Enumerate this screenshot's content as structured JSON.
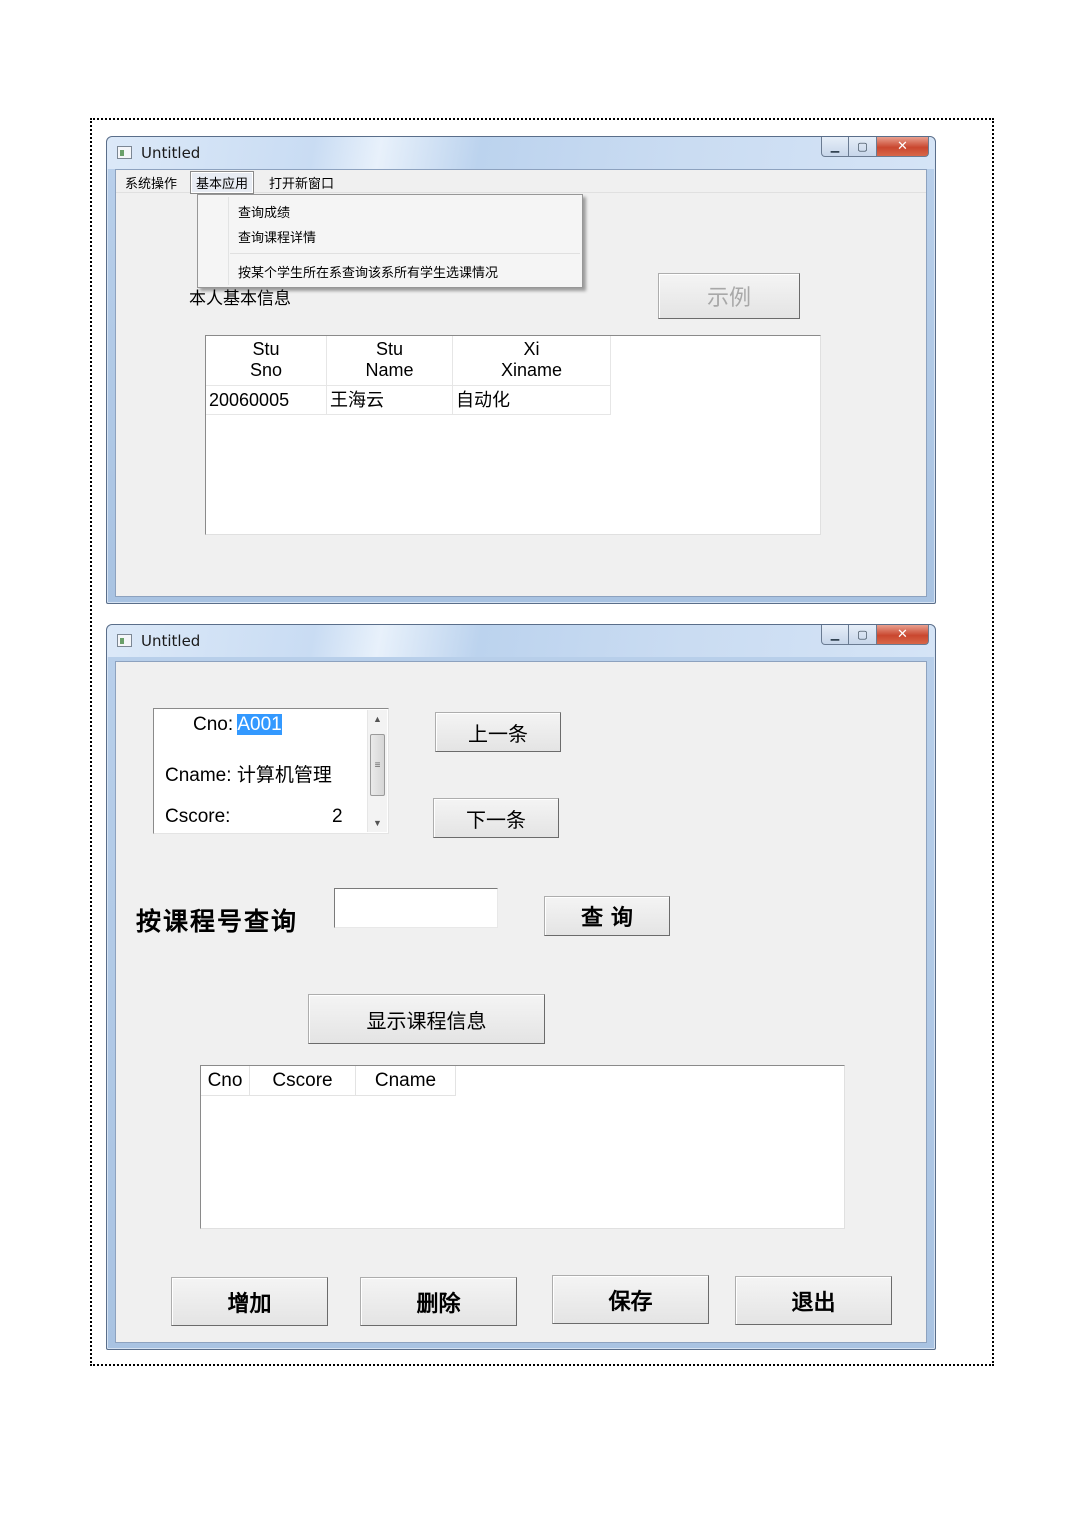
{
  "window1": {
    "title": "Untitled",
    "menu": [
      "系统操作",
      "基本应用",
      "打开新窗口"
    ],
    "dropdown": [
      "查询成绩",
      "查询课程详情",
      "按某个学生所在系查询该系所有学生选课情况"
    ],
    "basic_info_label": "本人基本信息",
    "example_button": "示例",
    "grid": {
      "columns": [
        "Stu\nSno",
        "Stu\nName",
        "Xi\nXiname"
      ],
      "rows": [
        [
          "20060005",
          "王海云",
          "自动化"
        ]
      ]
    }
  },
  "window2": {
    "title": "Untitled",
    "record": {
      "cno_label": "Cno:",
      "cno_value": "A001",
      "cname_label": "Cname:",
      "cname_value": "计算机管理",
      "cscore_label": "Cscore:",
      "cscore_value": "2"
    },
    "prev_button": "上一条",
    "next_button": "下一条",
    "query_label": "按课程号查询",
    "query_input_value": "",
    "query_button": "查 询",
    "show_button": "显示课程信息",
    "list_columns": [
      "Cno",
      "Cscore",
      "Cname"
    ],
    "buttons": {
      "add": "增加",
      "delete": "删除",
      "save": "保存",
      "exit": "退出"
    }
  }
}
